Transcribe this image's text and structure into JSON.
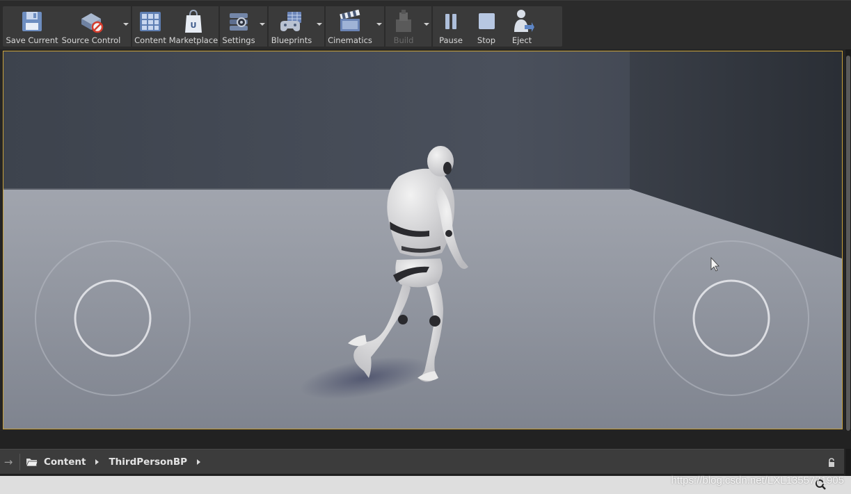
{
  "toolbar": {
    "buttons": [
      {
        "label": "Save Current",
        "icon": "save-icon"
      },
      {
        "label": "Source Control",
        "icon": "source-control-icon"
      },
      {
        "label": "Content",
        "icon": "content-icon"
      },
      {
        "label": "Marketplace",
        "icon": "marketplace-icon"
      },
      {
        "label": "Settings",
        "icon": "settings-icon"
      },
      {
        "label": "Blueprints",
        "icon": "blueprints-icon"
      },
      {
        "label": "Cinematics",
        "icon": "cinematics-icon"
      },
      {
        "label": "Build",
        "icon": "build-icon"
      },
      {
        "label": "Pause",
        "icon": "pause-icon"
      },
      {
        "label": "Stop",
        "icon": "stop-icon"
      },
      {
        "label": "Eject",
        "icon": "eject-icon"
      }
    ]
  },
  "content_browser": {
    "path": [
      "Content",
      "ThirdPersonBP"
    ]
  },
  "watermark": "https://blog.csdn.net/LXL1355771905",
  "colors": {
    "viewport_border": "#c9a23a",
    "toolbar_bg": "#3a3a3a",
    "floor": "#8c919c",
    "wall": "#3b404a"
  }
}
